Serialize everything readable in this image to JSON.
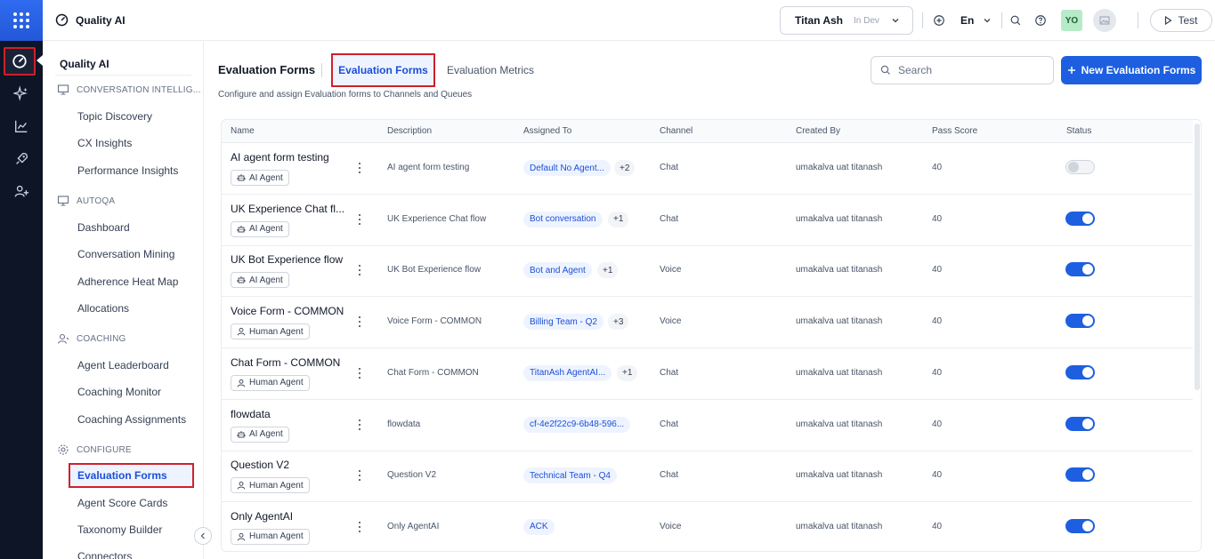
{
  "header": {
    "app_title": "Quality AI",
    "env_name": "Titan Ash",
    "env_tag": "In Dev",
    "language": "En",
    "avatar_initials": "YO",
    "test_label": "Test"
  },
  "sidebar": {
    "title": "Quality AI",
    "sections": [
      {
        "label": "CONVERSATION INTELLIG...",
        "items": [
          "Topic Discovery",
          "CX Insights",
          "Performance Insights"
        ]
      },
      {
        "label": "AUTOQA",
        "items": [
          "Dashboard",
          "Conversation Mining",
          "Adherence Heat Map",
          "Allocations"
        ]
      },
      {
        "label": "COACHING",
        "items": [
          "Agent Leaderboard",
          "Coaching Monitor",
          "Coaching Assignments"
        ]
      },
      {
        "label": "CONFIGURE",
        "items": [
          "Evaluation Forms",
          "Agent Score Cards",
          "Taxonomy Builder",
          "Connectors"
        ]
      }
    ],
    "active_item": "Evaluation Forms"
  },
  "main": {
    "title": "Evaluation Forms",
    "tabs": [
      "Evaluation Forms",
      "Evaluation Metrics"
    ],
    "active_tab": "Evaluation Forms",
    "subtitle": "Configure and assign Evaluation forms to Channels and Queues",
    "search_placeholder": "Search",
    "new_button": "New Evaluation Forms"
  },
  "table": {
    "columns": [
      "Name",
      "Description",
      "Assigned To",
      "Channel",
      "Created By",
      "Pass Score",
      "Status"
    ],
    "rows": [
      {
        "name": "AI agent form testing",
        "agent": "AI Agent",
        "description": "AI agent form testing",
        "assigned": "Default No Agent...",
        "more": "+2",
        "channel": "Chat",
        "created_by": "umakalva uat titanash",
        "pass_score": "40",
        "status": false
      },
      {
        "name": "UK Experience Chat fl...",
        "agent": "AI Agent",
        "description": "UK Experience Chat flow",
        "assigned": "Bot conversation",
        "more": "+1",
        "channel": "Chat",
        "created_by": "umakalva uat titanash",
        "pass_score": "40",
        "status": true
      },
      {
        "name": "UK Bot Experience flow",
        "agent": "AI Agent",
        "description": "UK Bot Experience flow",
        "assigned": "Bot and Agent",
        "more": "+1",
        "channel": "Voice",
        "created_by": "umakalva uat titanash",
        "pass_score": "40",
        "status": true
      },
      {
        "name": "Voice Form - COMMON",
        "agent": "Human Agent",
        "description": "Voice Form - COMMON",
        "assigned": "Billing Team - Q2",
        "more": "+3",
        "channel": "Voice",
        "created_by": "umakalva uat titanash",
        "pass_score": "40",
        "status": true
      },
      {
        "name": "Chat Form - COMMON",
        "agent": "Human Agent",
        "description": "Chat Form - COMMON",
        "assigned": "TitanAsh AgentAI...",
        "more": "+1",
        "channel": "Chat",
        "created_by": "umakalva uat titanash",
        "pass_score": "40",
        "status": true
      },
      {
        "name": "flowdata",
        "agent": "AI Agent",
        "description": "flowdata",
        "assigned": "cf-4e2f22c9-6b48-596...",
        "more": "",
        "channel": "Chat",
        "created_by": "umakalva uat titanash",
        "pass_score": "40",
        "status": true
      },
      {
        "name": "Question V2",
        "agent": "Human Agent",
        "description": "Question V2",
        "assigned": "Technical Team - Q4",
        "more": "",
        "channel": "Chat",
        "created_by": "umakalva uat titanash",
        "pass_score": "40",
        "status": true
      },
      {
        "name": "Only AgentAI",
        "agent": "Human Agent",
        "description": "Only AgentAI",
        "assigned": "ACK",
        "more": "",
        "channel": "Voice",
        "created_by": "umakalva uat titanash",
        "pass_score": "40",
        "status": true
      }
    ]
  },
  "colors": {
    "accent": "#1d5fe0",
    "highlight_border": "#d0202b",
    "rail_bg": "#0d1526"
  }
}
